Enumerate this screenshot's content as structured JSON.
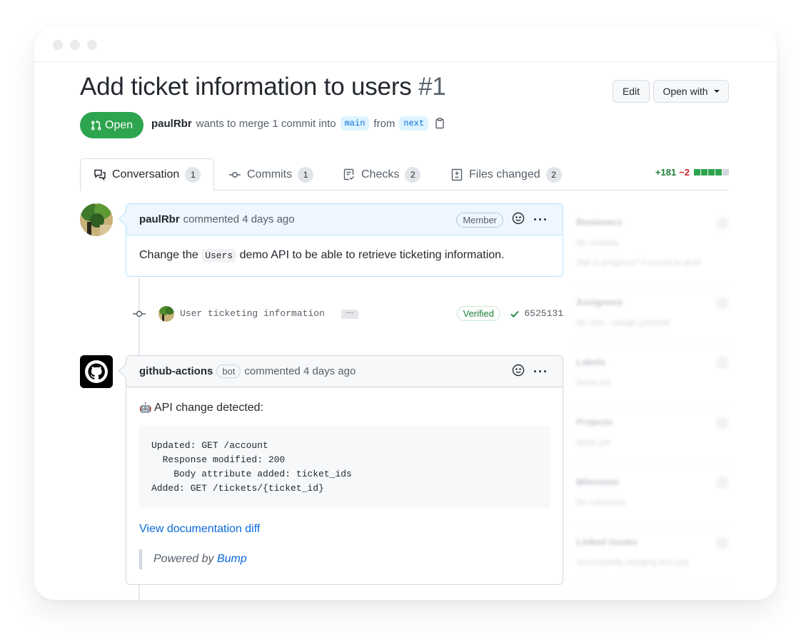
{
  "window": {
    "controls": [
      "close",
      "minimize",
      "maximize"
    ]
  },
  "header": {
    "title": "Add ticket information to users",
    "number": "#1",
    "edit_label": "Edit",
    "open_with_label": "Open with"
  },
  "status": {
    "state_label": "Open",
    "author": "paulRbr",
    "text_before": "wants to merge 1 commit into",
    "base_branch": "main",
    "text_between": "from",
    "head_branch": "next"
  },
  "tabs": [
    {
      "label": "Conversation",
      "count": "1",
      "icon": "comment-discussion-icon",
      "active": true
    },
    {
      "label": "Commits",
      "count": "1",
      "icon": "git-commit-icon",
      "active": false
    },
    {
      "label": "Checks",
      "count": "2",
      "icon": "checklist-icon",
      "active": false
    },
    {
      "label": "Files changed",
      "count": "2",
      "icon": "file-diff-icon",
      "active": false
    }
  ],
  "diffstat": {
    "additions": "+181",
    "deletions": "−2",
    "blocks": [
      "add",
      "add",
      "add",
      "add",
      "neutral"
    ],
    "colors": {
      "add": "#2da44e",
      "neutral": "#d0d7de"
    }
  },
  "comments": [
    {
      "author": "paulRbr",
      "action": "commented 4 days ago",
      "badge": "Member",
      "body_prefix": "Change the",
      "body_code": "Users",
      "body_suffix": "demo API to be able to retrieve ticketing information."
    },
    {
      "author": "github-actions",
      "bot_badge": "bot",
      "action": "commented 4 days ago",
      "intro_emoji": "🤖",
      "intro": "API change detected:",
      "code": "Updated: GET /account\n  Response modified: 200\n    Body attribute added: ticket_ids\nAdded: GET /tickets/{ticket_id}",
      "link": "View documentation diff",
      "quote_prefix": "Powered by",
      "quote_link": "Bump"
    }
  ],
  "commit": {
    "message": "User ticketing information",
    "ellipsis": "···",
    "verified": "Verified",
    "sha": "6525131"
  },
  "sidebar": {
    "sections": [
      {
        "title": "Reviewers",
        "lines": [
          "No reviews",
          "Still in progress? Convert to draft"
        ]
      },
      {
        "title": "Assignees",
        "lines": [
          "No one—assign yourself"
        ]
      },
      {
        "title": "Labels",
        "lines": [
          "None yet"
        ]
      },
      {
        "title": "Projects",
        "lines": [
          "None yet"
        ]
      },
      {
        "title": "Milestone",
        "lines": [
          "No milestone"
        ]
      },
      {
        "title": "Linked issues",
        "lines": [
          "Successfully merging this pull"
        ]
      }
    ]
  },
  "colors": {
    "open_green": "#2da44e",
    "link_blue": "#0969da",
    "deletion_red": "#cf222e"
  }
}
